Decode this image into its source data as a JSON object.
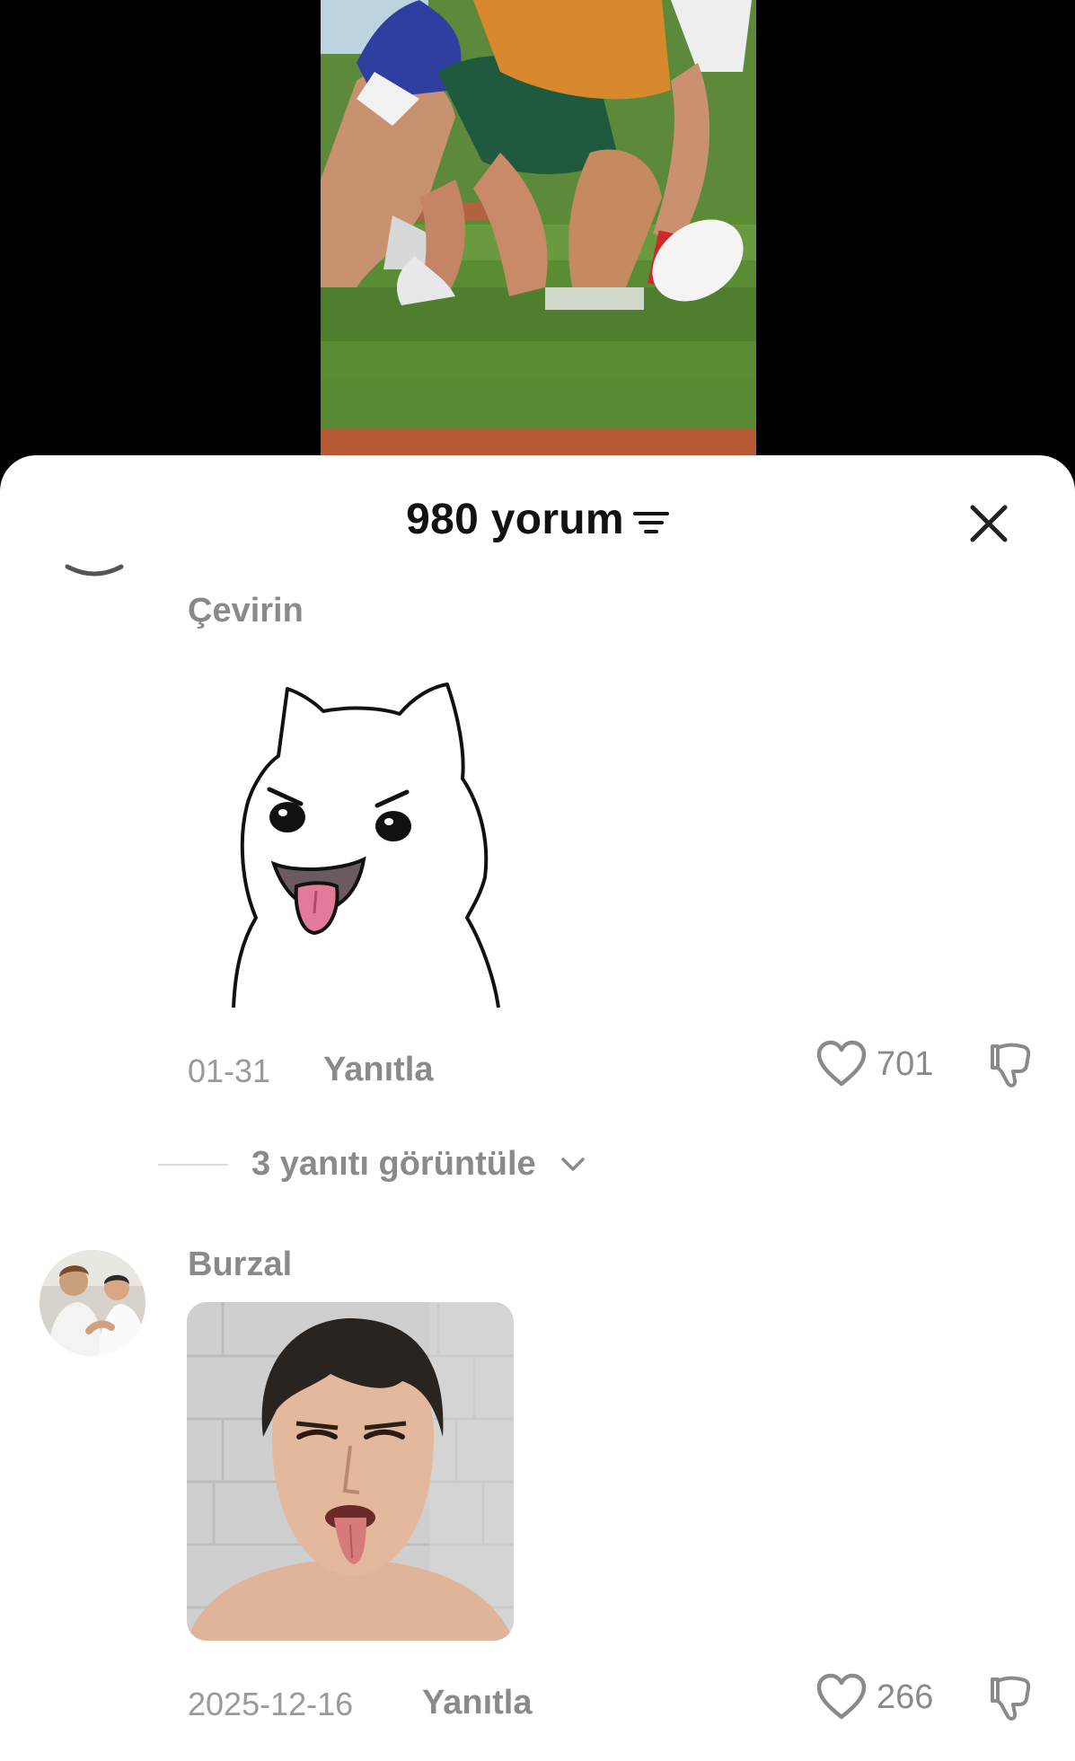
{
  "header": {
    "title": "980 yorum"
  },
  "comments": [
    {
      "username": "Çevirin",
      "date": "01-31",
      "reply_label": "Yanıtla",
      "likes": "701",
      "view_replies": "3 yanıtı görüntüle"
    },
    {
      "username": "Burzal",
      "date": "2025-12-16",
      "reply_label": "Yanıtla",
      "likes": "266"
    }
  ],
  "icons": {
    "sort": "sort-lines-icon",
    "close": "close-icon",
    "like": "heart-outline-icon",
    "dislike": "thumbs-down-icon",
    "chevron": "chevron-down-icon"
  },
  "colors": {
    "muted_text": "#8a8a8a",
    "title_text": "#111111",
    "video_bg": "#000000",
    "sheet_bg": "#ffffff"
  }
}
